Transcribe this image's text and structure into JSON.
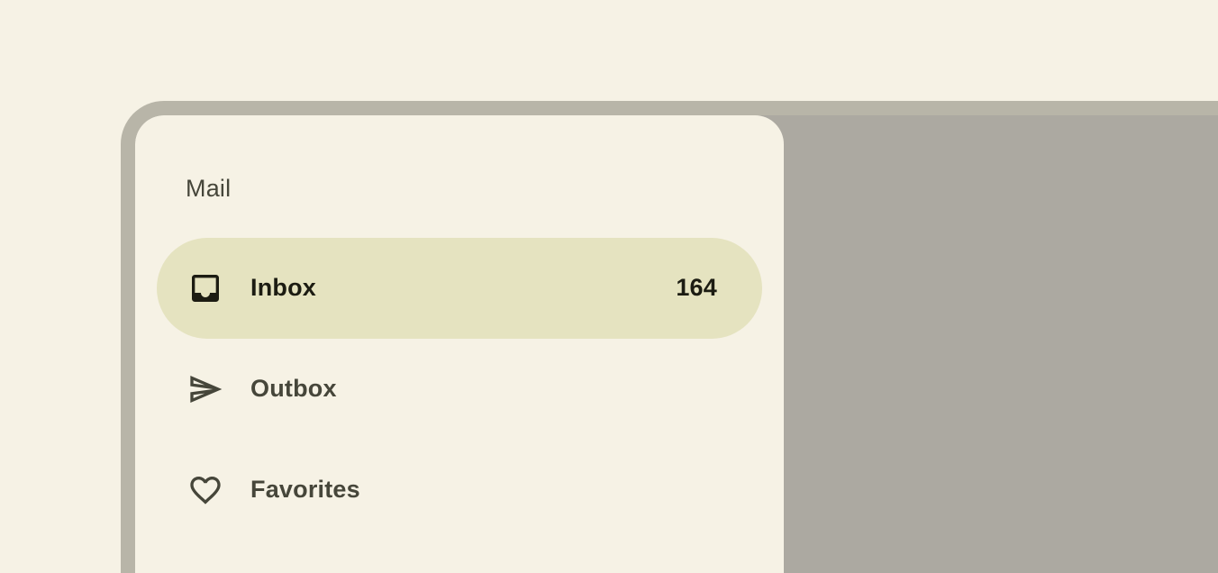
{
  "drawer": {
    "headline": "Mail",
    "items": [
      {
        "label": "Inbox",
        "badge": "164",
        "icon": "inbox-icon",
        "active": true
      },
      {
        "label": "Outbox",
        "badge": "",
        "icon": "send-icon",
        "active": false
      },
      {
        "label": "Favorites",
        "badge": "",
        "icon": "heart-icon",
        "active": false
      }
    ]
  },
  "colors": {
    "background": "#f6f2e5",
    "frame": "#b8b5a8",
    "scrim": "#aca9a1",
    "active_indicator": "#e5e3c0",
    "on_surface_variant": "#46463a",
    "on_secondary_container": "#1c1c12"
  }
}
